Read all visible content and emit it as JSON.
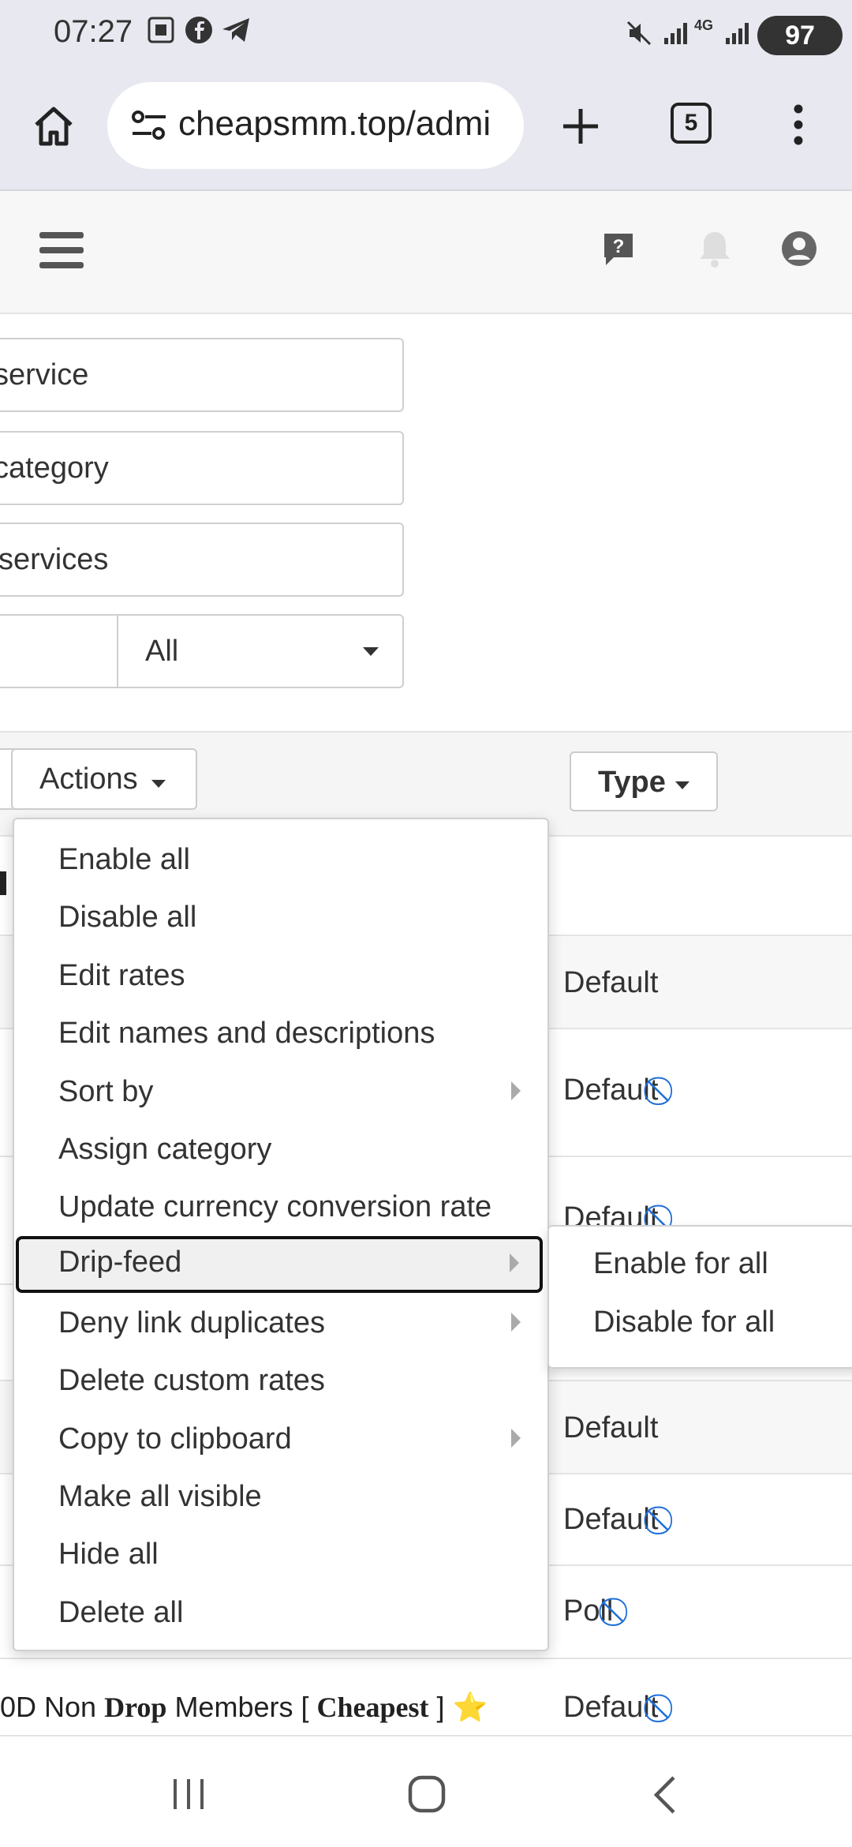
{
  "status_bar": {
    "time": "07:27",
    "battery": "97",
    "network": "4G"
  },
  "browser": {
    "url": "cheapsmm.top/admi",
    "tab_count": "5"
  },
  "filters": {
    "service_field": "service",
    "category_field": "category",
    "services_field": "services",
    "select_value": "All"
  },
  "toolbar": {
    "actions_label": "Actions",
    "type_label": "Type"
  },
  "rows": {
    "r1_type": "Default",
    "r2_type": "Default",
    "r3_type": "Default",
    "r5_type": "Default",
    "r6_type": "Default",
    "r7_type": "Poll",
    "r8_type": "Default",
    "r8_name_a": "0D Non ",
    "r8_name_b": "Drop",
    "r8_name_c": " Members [ ",
    "r8_name_d": "Cheapest",
    "r8_name_e": " ] ",
    "r8_star": "⭐"
  },
  "menu": {
    "items": [
      "Enable all",
      "Disable all",
      "Edit rates",
      "Edit names and descriptions",
      "Sort by",
      "Assign category",
      "Update currency conversion rate",
      "Drip-feed",
      "Deny link duplicates",
      "Delete custom rates",
      "Copy to clipboard",
      "Make all visible",
      "Hide all",
      "Delete all"
    ]
  },
  "submenu": {
    "items": [
      "Enable for all",
      "Disable for all"
    ]
  },
  "icons": {
    "home": "home-icon",
    "settings": "site-settings-icon",
    "plus": "new-tab-icon",
    "menu": "hamburger-icon",
    "help": "help-icon",
    "bell": "notification-bell-icon",
    "account": "account-icon",
    "ban": "ban-icon"
  },
  "colors": {
    "accent_blue": "#1e6fd9",
    "chrome_bar": "#e8e8f0"
  }
}
